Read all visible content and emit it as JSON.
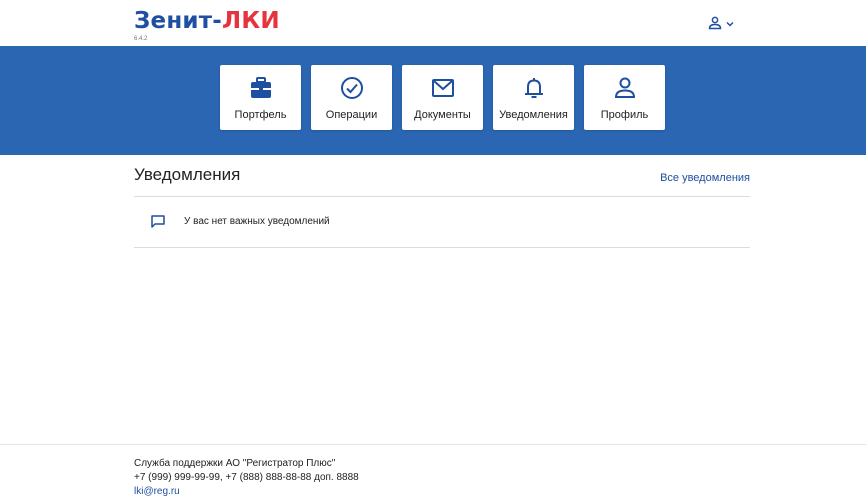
{
  "header": {
    "logo_part1": "Зенит-",
    "logo_part2": "ЛКИ",
    "version": "6.4.2",
    "user_icon": "user-icon",
    "menu_icon": "chevron-down-icon"
  },
  "nav": {
    "tiles": [
      {
        "label": "Портфель",
        "icon": "briefcase-icon"
      },
      {
        "label": "Операции",
        "icon": "check-circle-icon"
      },
      {
        "label": "Документы",
        "icon": "envelope-icon"
      },
      {
        "label": "Уведомления",
        "icon": "bell-icon"
      },
      {
        "label": "Профиль",
        "icon": "user-icon"
      }
    ]
  },
  "notifications": {
    "title": "Уведомления",
    "all_link": "Все уведомления",
    "empty_icon": "chat-icon",
    "empty_text": "У вас нет важных уведомлений"
  },
  "footer": {
    "support": "Служба поддержки АО \"Регистратор Плюс\"",
    "phones": "+7 (999) 999-99-99, +7 (888) 888-88-88 доп. 8888",
    "email": "lki@reg.ru"
  },
  "colors": {
    "brand_blue": "#2b66b3",
    "logo_blue": "#1e4fa0",
    "logo_red": "#e4353f"
  }
}
